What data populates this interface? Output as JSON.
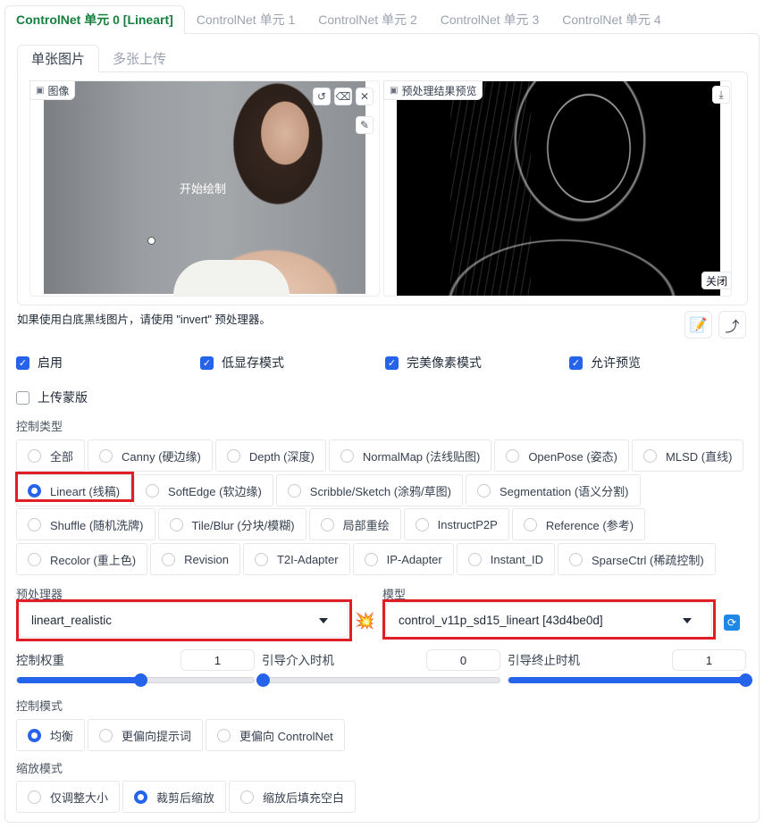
{
  "unit_tabs": [
    "ControlNet 单元 0 [Lineart]",
    "ControlNet 单元 1",
    "ControlNet 单元 2",
    "ControlNet 单元 3",
    "ControlNet 单元 4"
  ],
  "image_tabs": [
    "单张图片",
    "多张上传"
  ],
  "input_image": {
    "label": "图像",
    "canvas_text": "开始绘制"
  },
  "preview_image": {
    "label": "预处理结果预览",
    "close_label": "关闭"
  },
  "hint": "如果使用白底黑线图片，请使用 \"invert\" 预处理器。",
  "checkboxes": [
    {
      "label": "启用",
      "checked": true
    },
    {
      "label": "低显存模式",
      "checked": true
    },
    {
      "label": "完美像素模式",
      "checked": true
    },
    {
      "label": "允许预览",
      "checked": true
    },
    {
      "label": "上传蒙版",
      "checked": false
    }
  ],
  "control_type": {
    "label": "控制类型",
    "rows": [
      [
        "全部",
        "Canny (硬边缘)",
        "Depth (深度)",
        "NormalMap (法线贴图)",
        "OpenPose (姿态)",
        "MLSD (直线)"
      ],
      [
        "Lineart (线稿)",
        "SoftEdge (软边缘)",
        "Scribble/Sketch (涂鸦/草图)",
        "Segmentation (语义分割)"
      ],
      [
        "Shuffle (随机洗牌)",
        "Tile/Blur (分块/模糊)",
        "局部重绘",
        "InstructP2P",
        "Reference (参考)"
      ],
      [
        "Recolor (重上色)",
        "Revision",
        "T2I-Adapter",
        "IP-Adapter",
        "Instant_ID",
        "SparseCtrl (稀疏控制)"
      ]
    ],
    "selected": "Lineart (线稿)"
  },
  "preprocessor": {
    "label": "预处理器",
    "value": "lineart_realistic"
  },
  "model": {
    "label": "模型",
    "value": "control_v11p_sd15_lineart [43d4be0d]"
  },
  "sliders": [
    {
      "label": "控制权重",
      "value": "1",
      "fraction": 0.52
    },
    {
      "label": "引导介入时机",
      "value": "0",
      "fraction": 0.0
    },
    {
      "label": "引导终止时机",
      "value": "1",
      "fraction": 1.0
    }
  ],
  "control_mode": {
    "label": "控制模式",
    "options": [
      "均衡",
      "更偏向提示词",
      "更偏向 ControlNet"
    ],
    "selected": "均衡"
  },
  "resize_mode": {
    "label": "缩放模式",
    "options": [
      "仅调整大小",
      "裁剪后缩放",
      "缩放后填充空白"
    ],
    "selected": "裁剪后缩放"
  },
  "colors": {
    "accent": "#2563eb",
    "active_tab": "#15803d",
    "highlight": "#e11d26"
  },
  "icons": [
    "image-icon",
    "undo-icon",
    "eraser-icon",
    "close-icon",
    "brush-icon",
    "download-icon",
    "edit-icon",
    "send-icon",
    "explosion-icon",
    "refresh-icon"
  ]
}
